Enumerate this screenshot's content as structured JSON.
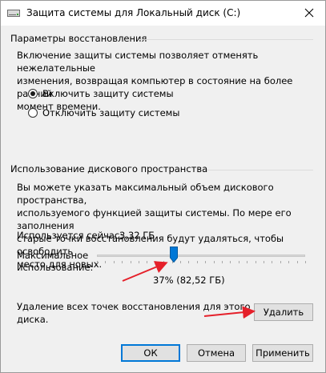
{
  "window": {
    "title": "Защита системы для Локальный диск (C:)"
  },
  "restore_settings": {
    "header": "Параметры восстановления",
    "description_lines": [
      "Включение защиты системы позволяет отменять нежелательные",
      "изменения, возвращая компьютер в состояние на более ранний",
      "момент времени."
    ],
    "options": [
      {
        "label": "Включить защиту системы",
        "selected": true
      },
      {
        "label": "Отключить защиту системы",
        "selected": false
      }
    ]
  },
  "disk_usage": {
    "header": "Использование дискового пространства",
    "description_lines": [
      "Вы можете указать максимальный объем дискового пространства,",
      "используемого функцией защиты системы. По мере его заполнения",
      "старые точки восстановления будут удаляться, чтобы освободить",
      "место для новых."
    ],
    "current_usage_label": "Используется сейчас:",
    "current_usage_value": "3,32 ГБ",
    "max_usage_label_lines": [
      "Максимальное",
      "использование:"
    ],
    "slider_fraction": 0.37,
    "slider_value_text": "37% (82,52 ГБ)"
  },
  "delete_section": {
    "text_lines": [
      "Удаление всех точек восстановления для этого",
      "диска."
    ],
    "button_label": "Удалить"
  },
  "footer": {
    "ok_label": "ОК",
    "cancel_label": "Отмена",
    "apply_label": "Применить"
  },
  "colors": {
    "accent": "#0078d7",
    "annotation_arrow": "#e5202a"
  }
}
